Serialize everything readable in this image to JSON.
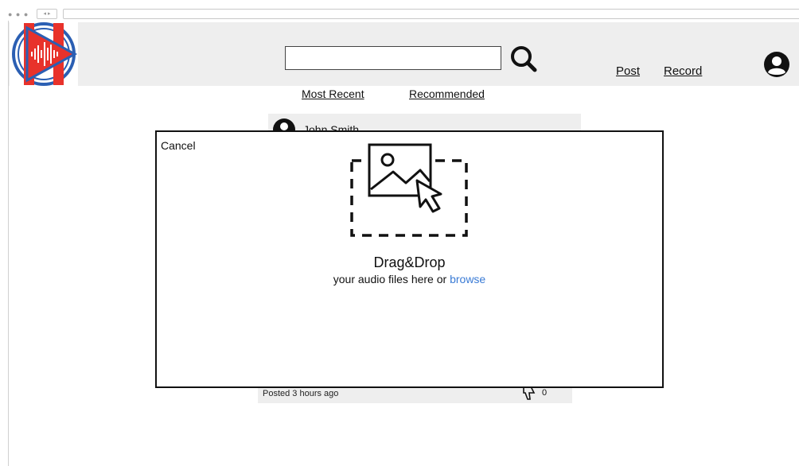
{
  "browser": {
    "nav_arrows": "◂ ▸"
  },
  "header": {
    "search": {
      "placeholder": "",
      "value": ""
    },
    "links": {
      "post": "Post",
      "record": "Record"
    }
  },
  "tabs": {
    "most_recent": "Most Recent",
    "recommended": "Recommended"
  },
  "feed": {
    "author": "John Smith",
    "posted": "Posted 3 hours ago",
    "dislikes": "0"
  },
  "modal": {
    "cancel": "Cancel",
    "title": "Drag&Drop",
    "subtitle_prefix": "your audio files here or",
    "browse": "browse"
  },
  "colors": {
    "header_bg": "#eeeeee",
    "link_blue": "#3a7bd5",
    "logo_red": "#e8322b",
    "logo_blue": "#2b5fb3"
  }
}
